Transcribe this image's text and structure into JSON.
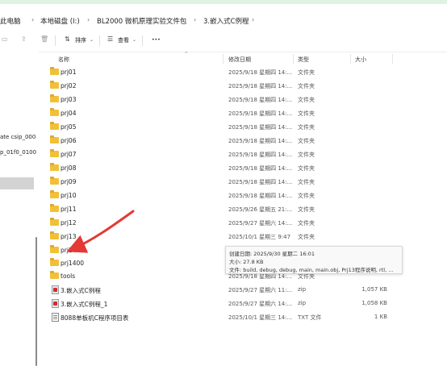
{
  "breadcrumbs": [
    "此电脑",
    "本地磁盘 (I:)",
    "BL2000 微机原理实验文件包",
    "3.嵌入式C例程"
  ],
  "toolbar": {
    "sort_label": "排序",
    "view_label": "查看",
    "more_label": "•••"
  },
  "nav": {
    "items": [
      "ate csip_000",
      "p_01f0_0100"
    ]
  },
  "columns": {
    "name": "名称",
    "date": "修改日期",
    "type": "类型",
    "size": "大小"
  },
  "rows": [
    {
      "name": "prj01",
      "date": "2025/9/18 星期四 14:...",
      "type": "文件夹",
      "size": "",
      "icon": "folder"
    },
    {
      "name": "prj02",
      "date": "2025/9/18 星期四 14:...",
      "type": "文件夹",
      "size": "",
      "icon": "folder"
    },
    {
      "name": "prj03",
      "date": "2025/9/18 星期四 14:...",
      "type": "文件夹",
      "size": "",
      "icon": "folder"
    },
    {
      "name": "prj04",
      "date": "2025/9/18 星期四 14:...",
      "type": "文件夹",
      "size": "",
      "icon": "folder"
    },
    {
      "name": "prj05",
      "date": "2025/9/18 星期四 14:...",
      "type": "文件夹",
      "size": "",
      "icon": "folder"
    },
    {
      "name": "prj06",
      "date": "2025/9/18 星期四 14:...",
      "type": "文件夹",
      "size": "",
      "icon": "folder"
    },
    {
      "name": "prj07",
      "date": "2025/9/18 星期四 14:...",
      "type": "文件夹",
      "size": "",
      "icon": "folder"
    },
    {
      "name": "prj08",
      "date": "2025/9/18 星期四 14:...",
      "type": "文件夹",
      "size": "",
      "icon": "folder"
    },
    {
      "name": "prj09",
      "date": "2025/9/18 星期四 14:...",
      "type": "文件夹",
      "size": "",
      "icon": "folder"
    },
    {
      "name": "prj10",
      "date": "2025/9/18 星期四 14:...",
      "type": "文件夹",
      "size": "",
      "icon": "folder"
    },
    {
      "name": "prj11",
      "date": "2025/9/26 星期五 21:...",
      "type": "文件夹",
      "size": "",
      "icon": "folder"
    },
    {
      "name": "prj12",
      "date": "2025/9/27 星期六 14:...",
      "type": "文件夹",
      "size": "",
      "icon": "folder"
    },
    {
      "name": "prj13",
      "date": "2025/10/1 星期三 9:47",
      "type": "文件夹",
      "size": "",
      "icon": "folder"
    },
    {
      "name": "prj14",
      "date": "",
      "type": "",
      "size": "",
      "icon": "folder"
    },
    {
      "name": "prj1400",
      "date": "",
      "type": "",
      "size": "",
      "icon": "folder"
    },
    {
      "name": "tools",
      "date": "2025/9/18 星期四 14:...",
      "type": "文件夹",
      "size": "",
      "icon": "folder"
    },
    {
      "name": "3.嵌入式C例程",
      "date": "2025/9/27 星期六 11:...",
      "type": "zip",
      "size": "1,057 KB",
      "icon": "zip"
    },
    {
      "name": "3.嵌入式C例程_1",
      "date": "2025/9/27 星期六 14:...",
      "type": "zip",
      "size": "1,058 KB",
      "icon": "zip"
    },
    {
      "name": "8088单板机C程序项目表",
      "date": "2025/10/1 星期三 14:...",
      "type": "TXT 文件",
      "size": "1 KB",
      "icon": "txt"
    }
  ],
  "tooltip": {
    "created": "创建日期: 2025/9/30 星期二 16:01",
    "size": "大小: 27.8 KB",
    "files": "文件: build, debug, debug, main, main.obj, Prj13程序说明, rtl, ..."
  },
  "colors": {
    "folder": "#f2c038",
    "arrow": "#e53935",
    "selection": "#d3d3d3"
  }
}
